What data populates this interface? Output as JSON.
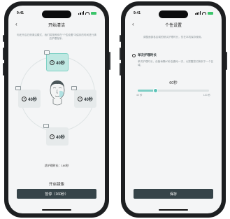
{
  "colors": {
    "accent": "#5cc3b8",
    "button": "#364449",
    "background": "#f4f5f6"
  },
  "status_bar": {
    "time": "9:41"
  },
  "cleaning_screen": {
    "title": "开始清洁",
    "back_icon": "chevron-left-icon",
    "description": "你还开启右侧清洁模式，我们将按照你在“个性设置”中保存的时间进行清洁护理程序。",
    "zones": [
      {
        "position": "top",
        "label": "40秒",
        "active": true
      },
      {
        "position": "left",
        "label": "40秒",
        "active": false
      },
      {
        "position": "right",
        "label": "40秒",
        "active": false
      },
      {
        "position": "bottom",
        "label": "40秒",
        "active": false
      }
    ],
    "total_time": "总护理时长：160秒",
    "start_label": "开启镜像",
    "pause_button": "暂停（160秒）"
  },
  "settings_screen": {
    "title": "个性设置",
    "back_icon": "chevron-left-icon",
    "description": "调整面部各区域的默认护理时长，仅在本机保存使用。",
    "section_title": "单次护理时长",
    "section_description": "单次护理时长，设备每隔40秒会震动一次，以提醒您切换到下一个区域。",
    "slider": {
      "value_label": "60秒",
      "min_label": "40 秒",
      "max_label": "120 秒",
      "value": 60,
      "min": 40,
      "max": 120
    },
    "save_button": "保存"
  }
}
